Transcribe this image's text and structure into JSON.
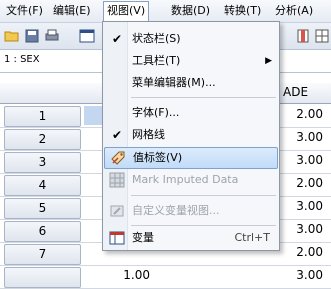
{
  "menubar": {
    "items": [
      {
        "label": "文件(F)"
      },
      {
        "label": "编辑(E)"
      },
      {
        "label": "视图(V)"
      },
      {
        "label": "数据(D)"
      },
      {
        "label": "转换(T)"
      },
      {
        "label": "分析(A)"
      }
    ],
    "active_index": 2
  },
  "cellbar": {
    "reference": "1 : SEX"
  },
  "grid": {
    "visible_column_header": "ADE",
    "rows": [
      {
        "label": "1",
        "grade": "2.00"
      },
      {
        "label": "2",
        "grade": "3.00"
      },
      {
        "label": "3",
        "grade": "3.00"
      },
      {
        "label": "4",
        "grade": "2.00"
      },
      {
        "label": "5",
        "grade": "3.00"
      },
      {
        "label": "6",
        "grade": "3.00"
      },
      {
        "label": "7",
        "grade": "2.00"
      }
    ],
    "partial_row": {
      "label": "",
      "col_value": "1.00",
      "grade": "3.00"
    }
  },
  "view_menu": {
    "items": [
      {
        "label": "状态栏(S)",
        "checked": true
      },
      {
        "label": "工具栏(T)",
        "submenu": true
      },
      {
        "label": "菜单编辑器(M)..."
      },
      {
        "label": "字体(F)..."
      },
      {
        "label": "网格线",
        "checked": true
      },
      {
        "label": "值标签(V)",
        "highlighted": true,
        "icon": "value-labels-icon"
      },
      {
        "label": "Mark Imputed Data",
        "disabled": true,
        "icon": "imputed-data-icon"
      },
      {
        "label": "自定义变量视图...",
        "disabled": true,
        "icon": "custom-view-icon"
      },
      {
        "label": "变量",
        "shortcut": "Ctrl+T",
        "icon": "variables-icon"
      }
    ]
  }
}
